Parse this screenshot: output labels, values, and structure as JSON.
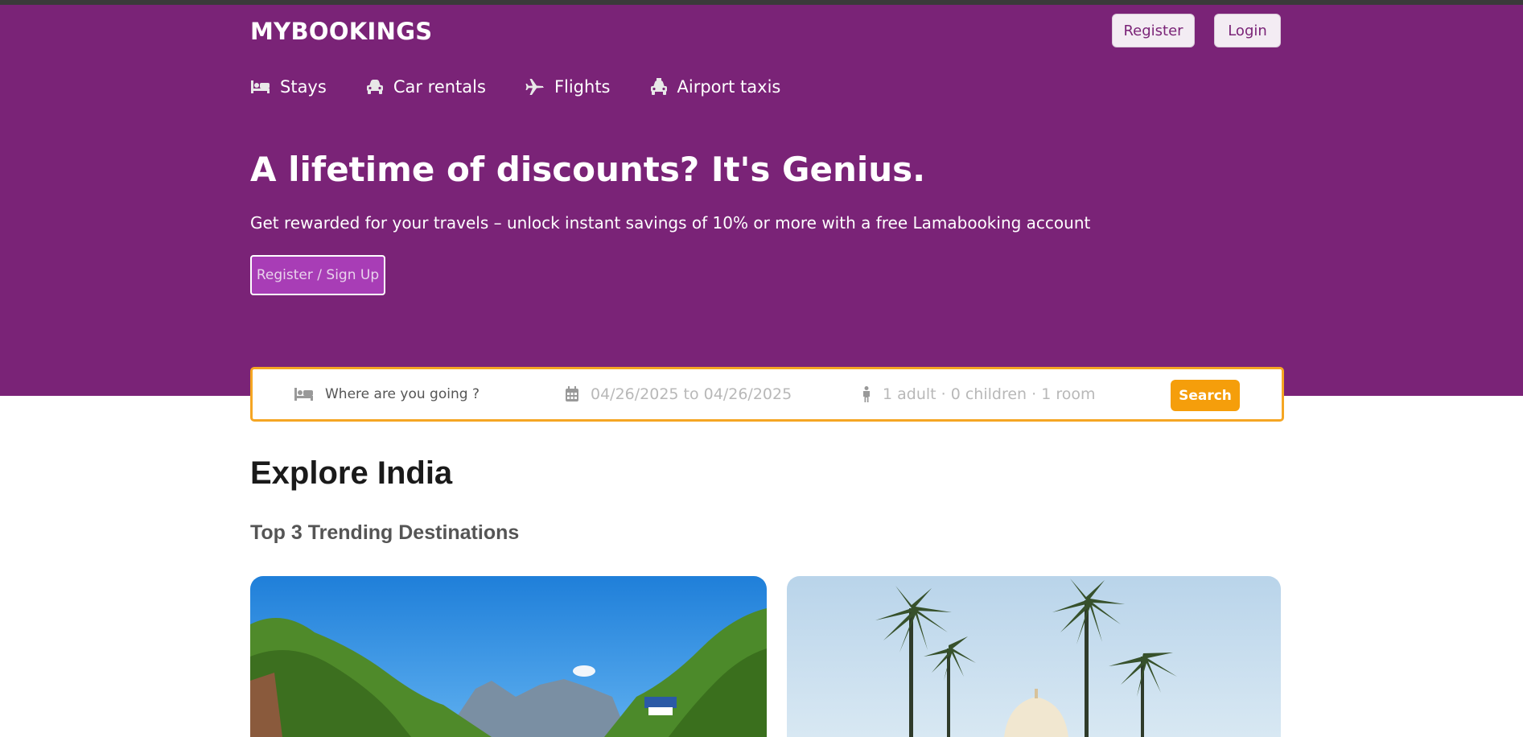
{
  "header": {
    "logo": "MYBOOKINGS",
    "register_label": "Register",
    "login_label": "Login"
  },
  "nav": {
    "items": [
      {
        "label": "Stays",
        "icon": "bed-icon"
      },
      {
        "label": "Car rentals",
        "icon": "car-icon"
      },
      {
        "label": "Flights",
        "icon": "plane-icon"
      },
      {
        "label": "Airport taxis",
        "icon": "taxi-icon"
      }
    ]
  },
  "hero": {
    "title": "A lifetime of discounts? It's Genius.",
    "subtitle": "Get rewarded for your travels – unlock instant savings of 10% or more with a free Lamabooking account",
    "cta_label": "Register / Sign Up"
  },
  "search": {
    "destination_placeholder": "Where are you going ?",
    "dates": "04/26/2025 to 04/26/2025",
    "guests": "1 adult · 0 children · 1 room",
    "button_label": "Search"
  },
  "explore": {
    "title": "Explore India",
    "subtitle": "Top 3 Trending Destinations"
  },
  "colors": {
    "brand": "#7a2377",
    "accent": "#f59e0b",
    "cta": "#a83db6"
  }
}
